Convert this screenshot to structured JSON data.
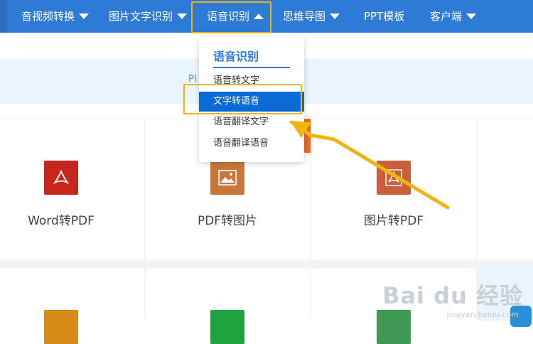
{
  "nav": {
    "items": [
      {
        "label": "音视频转换"
      },
      {
        "label": "图片文字识别"
      },
      {
        "label": "语音识别"
      },
      {
        "label": "思维导图"
      },
      {
        "label": "PPT模板"
      },
      {
        "label": "客户端"
      }
    ]
  },
  "strip": {
    "link_text": "PI"
  },
  "dropdown": {
    "title": "语音识别",
    "items": [
      {
        "label": "语音转文字"
      },
      {
        "label": "文字转语音",
        "active": true
      },
      {
        "label": "语音翻译文字"
      },
      {
        "label": "语音翻译语音"
      }
    ]
  },
  "tools": [
    {
      "label": "Word转PDF",
      "color": "#c8261c",
      "icon": "pdf-icon"
    },
    {
      "label": "PDF转图片",
      "color": "#c8773a",
      "icon": "image-icon"
    },
    {
      "label": "图片转PDF",
      "color": "#c9603a",
      "icon": "pdf-icon"
    }
  ],
  "bottom_icons": [
    {
      "color": "#d78a18",
      "icon": "document-icon"
    },
    {
      "color": "#1ea33e",
      "icon": "document-icon"
    },
    {
      "color": "#3e9a55",
      "icon": "document-icon"
    }
  ],
  "colors": {
    "nav_bg": "#2e7bd6",
    "highlight": "#f1b40f",
    "active_item": "#0a6bd6"
  },
  "watermark": {
    "main": "Bai du 经验",
    "sub": "jingyan.baidu.com"
  }
}
